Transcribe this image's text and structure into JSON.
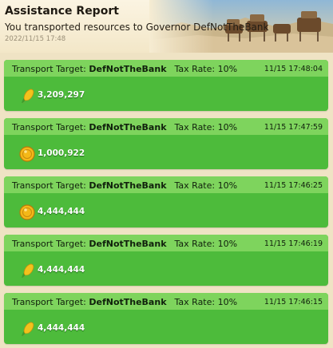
{
  "report": {
    "title": "Assistance Report",
    "subtitle": "You transported resources to Governor DefNotTheBank",
    "date": "2022/11/15 17:48"
  },
  "labels": {
    "transport_target": "Transport Target:",
    "tax_rate": "Tax Rate: 10%"
  },
  "entries": [
    {
      "target": "DefNotTheBank",
      "time": "11/15 17:48:04",
      "resource": "corn-icon",
      "amount": "3,209,297"
    },
    {
      "target": "DefNotTheBank",
      "time": "11/15 17:47:59",
      "resource": "gold-coin-icon",
      "amount": "1,000,922"
    },
    {
      "target": "DefNotTheBank",
      "time": "11/15 17:46:25",
      "resource": "gold-coin-icon",
      "amount": "4,444,444"
    },
    {
      "target": "DefNotTheBank",
      "time": "11/15 17:46:19",
      "resource": "corn-icon",
      "amount": "4,444,444"
    },
    {
      "target": "DefNotTheBank",
      "time": "11/15 17:46:15",
      "resource": "corn-icon",
      "amount": "4,444,444"
    }
  ],
  "colors": {
    "card_body": "#4dbb3b",
    "card_header": "#7ed45d",
    "page_background": "#efe3c4"
  }
}
